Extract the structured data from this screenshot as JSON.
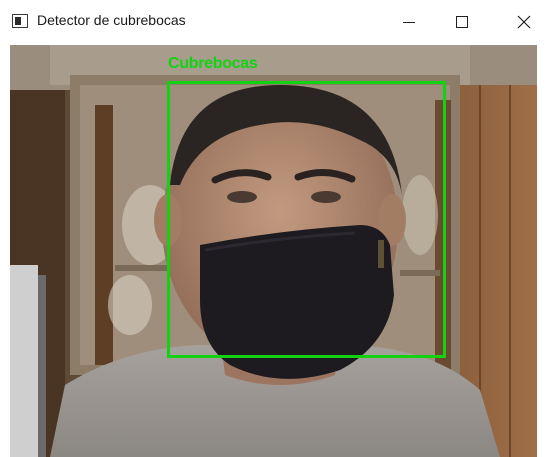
{
  "window": {
    "title": "Detector de cubrebocas",
    "controls": {
      "minimize_icon": "minimize-icon",
      "maximize_icon": "maximize-icon",
      "close_icon": "close-icon"
    }
  },
  "detection": {
    "label": "Cubrebocas",
    "box_color": "#12d212"
  }
}
